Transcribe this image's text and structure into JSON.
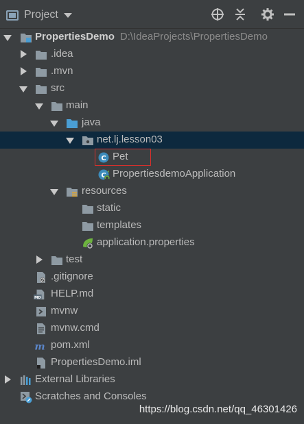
{
  "toolbar": {
    "title": "Project",
    "icons": [
      "project-view-icon",
      "dropdown-caret-icon",
      "locate-icon",
      "collapse-all-icon",
      "gear-icon",
      "hide-icon"
    ]
  },
  "tree": {
    "root": {
      "label": "PropertiesDemo",
      "path": "D:\\IdeaProjects\\PropertiesDemo"
    },
    "idea": ".idea",
    "mvn": ".mvn",
    "src": "src",
    "main": "main",
    "java": "java",
    "package": "net.lj.lesson03",
    "pet": "Pet",
    "app": "PropertiesdemoApplication",
    "resources": "resources",
    "static": "static",
    "templates": "templates",
    "app_props": "application.properties",
    "test": "test",
    "gitignore": ".gitignore",
    "help": "HELP.md",
    "mvnw": "mvnw",
    "mvnw_cmd": "mvnw.cmd",
    "pom": "pom.xml",
    "iml": "PropertiesDemo.iml",
    "ext_libs": "External Libraries",
    "scratches": "Scratches and Consoles"
  },
  "watermark": "https://blog.csdn.net/qq_46301426",
  "colors": {
    "background": "#3c3f41",
    "selection": "#0d293e",
    "folder": "#8e9aa3",
    "source_folder": "#4a9ed4",
    "class_icon": "#3c8bba",
    "highlight_box": "#d9302b"
  }
}
